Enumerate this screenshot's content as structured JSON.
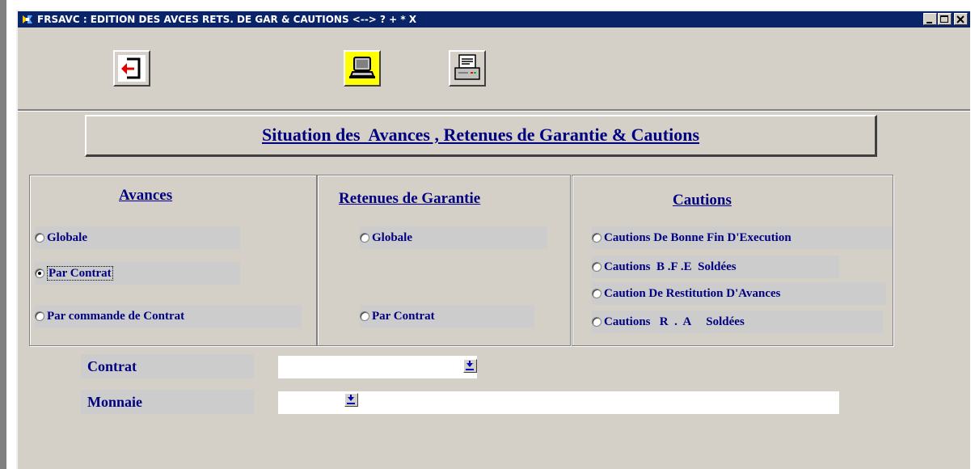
{
  "window": {
    "title": "FRSAVC : EDITION DES AVCES RETS. DE GAR & CAUTIONS <--> ? + * X",
    "controls": [
      "minimize",
      "maximize",
      "close"
    ]
  },
  "toolbar": {
    "buttons": [
      {
        "icon": "exit-icon"
      },
      {
        "icon": "screen-preview-icon",
        "background": "#ffff00"
      },
      {
        "icon": "printer-icon"
      }
    ]
  },
  "heading": "Situation des  Avances , Retenues de Garantie & Cautions",
  "groups": {
    "avances": {
      "title": "Avances",
      "options": [
        "Globale",
        "Par Contrat",
        "Par commande de Contrat"
      ],
      "selected": "Par Contrat"
    },
    "retenues": {
      "title": "Retenues de Garantie",
      "options": [
        "Globale",
        "Par Contrat"
      ]
    },
    "cautions": {
      "title": "Cautions",
      "options": [
        "Cautions De Bonne Fin D'Execution",
        "Cautions  B .F .E  Soldées",
        "Caution De Restitution D'Avances",
        "Cautions   R  .  A     Soldées"
      ]
    }
  },
  "fields": {
    "contrat": {
      "label": "Contrat",
      "value": ""
    },
    "monnaie": {
      "label": "Monnaie",
      "value": ""
    }
  },
  "colors": {
    "title_bar": "#0a246a",
    "label_text": "#000080",
    "window_bg": "#d4d0c8"
  }
}
